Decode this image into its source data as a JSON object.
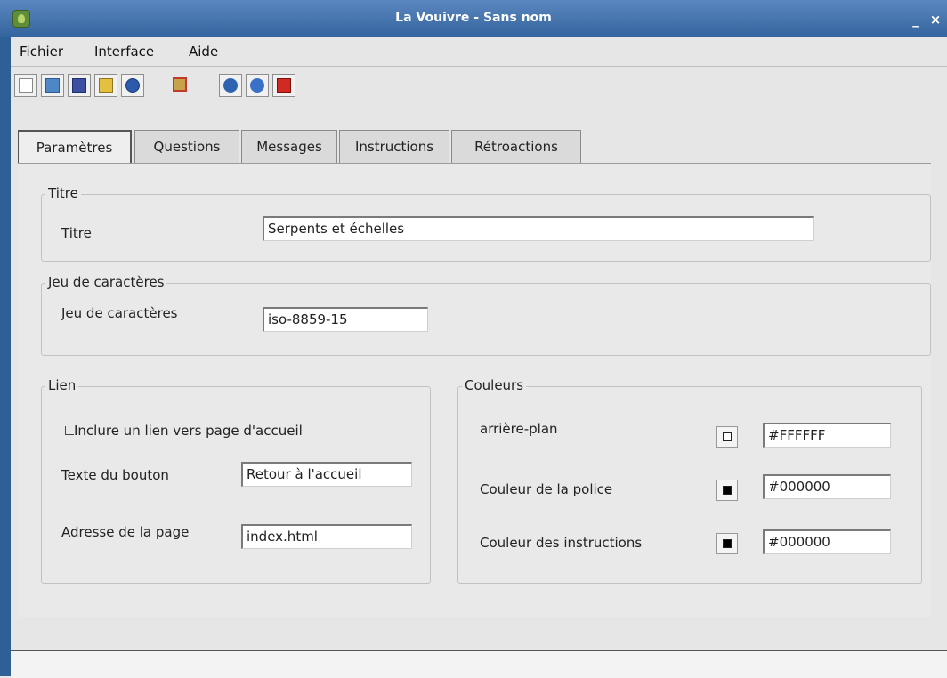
{
  "window": {
    "title": "La Vouivre - Sans nom"
  },
  "menu": [
    "Fichier",
    "Interface",
    "Aide"
  ],
  "toolbar": [
    "new-document-icon",
    "open-folder-icon",
    "save-icon",
    "save-as-icon",
    "globe-icon",
    "preview-icon",
    "info-icon",
    "help-icon",
    "exit-icon"
  ],
  "tabs": [
    "Paramètres",
    "Questions",
    "Messages",
    "Instructions",
    "Rétroactions"
  ],
  "titre_group": {
    "title": "Titre",
    "label": "Titre",
    "value": "Serpents et échelles"
  },
  "charset_group": {
    "title": "Jeu de caractères",
    "label": "Jeu de caractères",
    "value": "iso-8859-15"
  },
  "lien_group": {
    "title": "Lien",
    "checkbox_label": "Inclure un lien vers page d'accueil",
    "checkbox_checked": false,
    "button_text_label": "Texte du bouton",
    "button_text_value": "Retour à l'accueil",
    "address_label": "Adresse de la page",
    "address_value": "index.html"
  },
  "couleurs_group": {
    "title": "Couleurs",
    "rows": [
      {
        "label": "arrière-plan",
        "value": "#FFFFFF",
        "swatch": "#FFFFFF"
      },
      {
        "label": "Couleur de la police",
        "value": "#000000",
        "swatch": "#000000"
      },
      {
        "label": "Couleur des instructions",
        "value": "#000000",
        "swatch": "#000000"
      }
    ]
  }
}
